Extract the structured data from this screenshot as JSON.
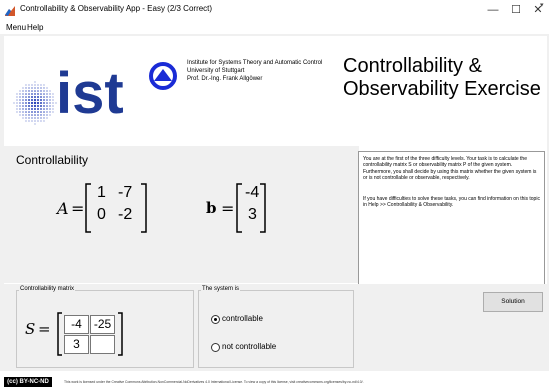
{
  "window": {
    "title": "Controllability & Observability App - Easy (2/3 Correct)",
    "minimize": "—",
    "maximize": "☐",
    "close": "✕"
  },
  "menu": {
    "items": [
      "Menu",
      "Help"
    ]
  },
  "header": {
    "institute_line1": "Institute for Systems Theory and Automatic Control",
    "institute_line2": "University of Stuttgart",
    "institute_line3": "Prof. Dr.-Ing. Frank Allgöwer",
    "logo_text": "ist",
    "app_title_line1": "Controllability &",
    "app_title_line2": "Observability Exercise"
  },
  "controllability": {
    "title": "Controllability",
    "A_label": "A",
    "A_matrix": [
      [
        "1",
        "-7"
      ],
      [
        "0",
        "-2"
      ]
    ],
    "b_label": "b",
    "b_vector": [
      "-4",
      "3"
    ]
  },
  "info": {
    "p1": "You are at the first of the three difficulty levels. Your task is to calculate the controllability matrix S or observability matrix P of the given system. Furthermore, you shall decide by using this matrix whether the given system is or is not controllable or observable, respectively.",
    "p2": "If you have difficulties to solve these tasks, you can find information on this topic in Help >> Controllability & Observability."
  },
  "controllability_matrix": {
    "legend": "Controllability matrix",
    "S_label": "S",
    "cells": [
      [
        "-4",
        "-25"
      ],
      [
        "3",
        ""
      ]
    ]
  },
  "system_is": {
    "legend": "The system is",
    "options": [
      {
        "label": "controllable",
        "selected": true
      },
      {
        "label": "not controllable",
        "selected": false
      }
    ]
  },
  "solution_button": "Solution",
  "footer": {
    "badge": "(cc) BY-NC-ND",
    "license_text": "This work is licensed under the Creative Commons Attribution-NonCommercial-NoDerivatives 4.0 International License. To view a copy of this license, visit creativecommons.org/licenses/by-nc-nd/4.0/."
  },
  "colors": {
    "accent_blue": "#1a2bd6",
    "logo_dark": "#1f3a93",
    "dots_blue": "#2540b8",
    "title_bar_bg": "#ffffff",
    "panel_bg": "#f0f0f0"
  }
}
